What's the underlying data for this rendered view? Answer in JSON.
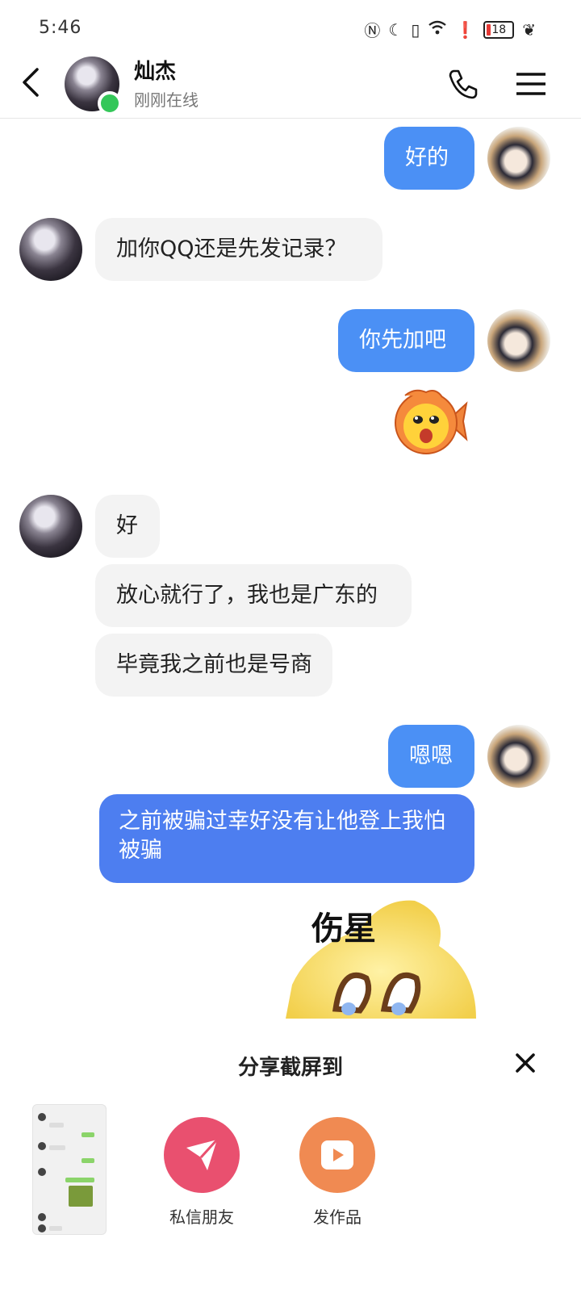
{
  "status_bar": {
    "time": "5:46",
    "battery_level": "18",
    "icons": [
      "nfc-icon",
      "moon-icon",
      "vibrate-icon",
      "wifi-icon",
      "alert-icon",
      "battery-icon",
      "leaf-icon"
    ]
  },
  "header": {
    "name": "灿杰",
    "status": "刚刚在线"
  },
  "messages": [
    {
      "from": "self",
      "text": "好的"
    },
    {
      "from": "peer",
      "text": "加你QQ还是先发记录？"
    },
    {
      "from": "self",
      "text": "你先加吧"
    },
    {
      "from": "self",
      "type": "sticker",
      "sticker": "fish-emoji"
    },
    {
      "from": "peer",
      "text": "好"
    },
    {
      "from": "peer",
      "text": "放心就行了，我也是广东的"
    },
    {
      "from": "peer",
      "text": "毕竟我之前也是号商"
    },
    {
      "from": "self",
      "text": "嗯嗯"
    },
    {
      "from": "self",
      "text": "之前被骗过幸好没有让他登上我怕被骗"
    },
    {
      "from": "self",
      "type": "sticker",
      "sticker": "crying-star",
      "caption": "伤星"
    }
  ],
  "share_sheet": {
    "title": "分享截屏到",
    "actions": [
      {
        "label": "私信朋友",
        "icon": "paper-plane-icon",
        "color": "#e9506f"
      },
      {
        "label": "发作品",
        "icon": "play-icon",
        "color": "#f08a52"
      }
    ]
  },
  "colors": {
    "bubble_out": "#4b90f5",
    "bubble_in": "#f3f3f3",
    "online": "#34c759"
  }
}
